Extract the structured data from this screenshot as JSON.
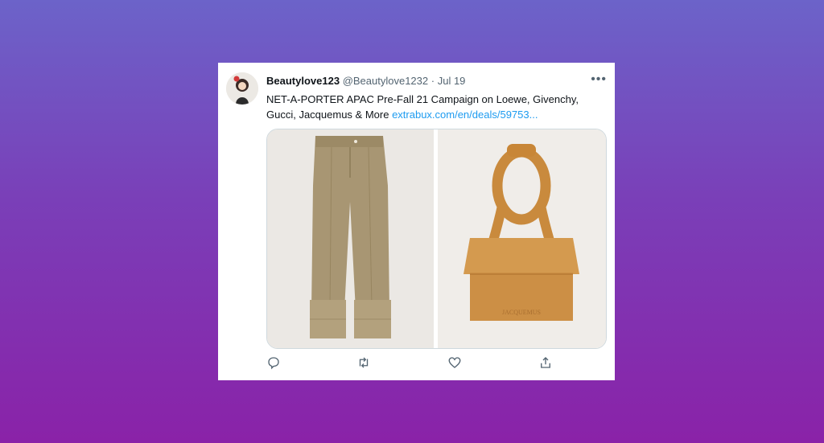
{
  "tweet": {
    "display_name": "Beautylove123",
    "handle": "@Beautylove1232",
    "separator": "·",
    "date": "Jul 19",
    "text": "NET-A-PORTER APAC Pre-Fall 21 Campaign on Loewe, Givenchy, Gucci, Jacquemus & More ",
    "link_text": "extrabux.com/en/deals/59753...",
    "more_label": "•••"
  },
  "media": {
    "left_image": "trousers-photo",
    "right_image": "handbag-photo",
    "bag_brand_text": "JACQUEMUS"
  },
  "actions": {
    "icons": [
      "reply-icon",
      "retweet-icon",
      "like-icon",
      "share-icon"
    ]
  }
}
